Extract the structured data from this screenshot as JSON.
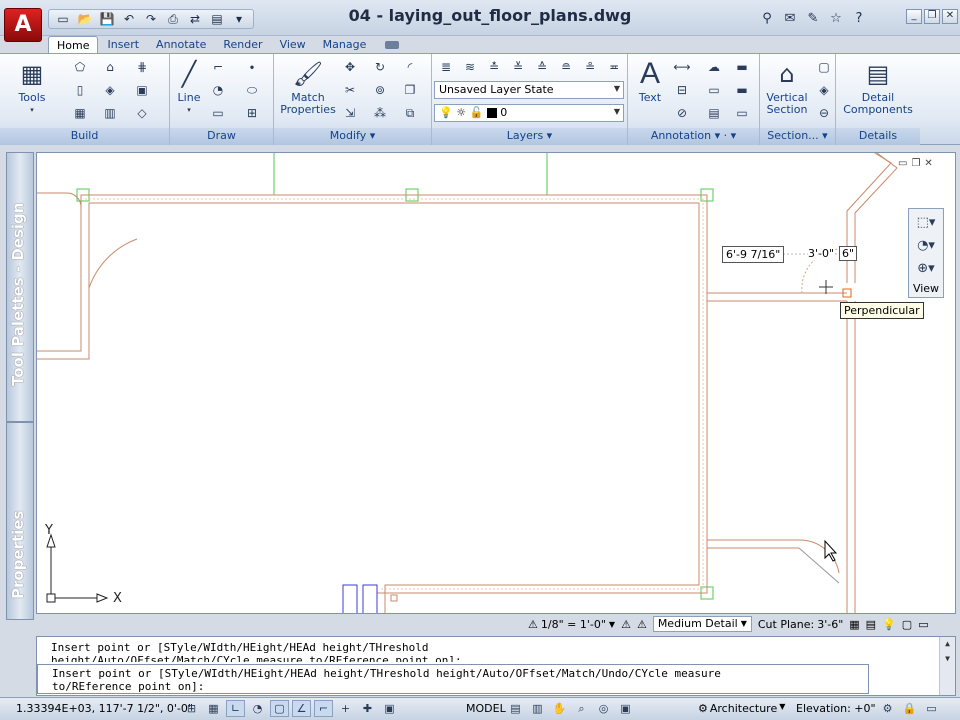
{
  "app": {
    "logo": "A",
    "document_title": "04 - laying_out_floor_plans.dwg"
  },
  "quick_access": [
    "new-icon",
    "open-icon",
    "save-icon",
    "undo-icon",
    "redo-icon",
    "print-icon",
    "publish-icon",
    "properties-icon"
  ],
  "info_tools": [
    "binoculars-icon",
    "subscription-icon",
    "tools-icon",
    "star-icon",
    "help-icon"
  ],
  "window_controls": {
    "minimize": "_",
    "restore": "❐",
    "close": "✕"
  },
  "tabs": [
    {
      "label": "Home",
      "active": true
    },
    {
      "label": "Insert",
      "active": false
    },
    {
      "label": "Annotate",
      "active": false
    },
    {
      "label": "Render",
      "active": false
    },
    {
      "label": "View",
      "active": false
    },
    {
      "label": "Manage",
      "active": false
    }
  ],
  "ribbon": {
    "build": {
      "title": "Build",
      "tools_label": "Tools"
    },
    "draw": {
      "title": "Draw",
      "line_label": "Line"
    },
    "modify": {
      "title": "Modify",
      "match_label_1": "Match",
      "match_label_2": "Properties"
    },
    "layers": {
      "title": "Layers",
      "layer_state": "Unsaved Layer State",
      "current_layer": "0"
    },
    "annotation": {
      "title": "Annotation",
      "text_label": "Text"
    },
    "section": {
      "title": "Section...",
      "vertical_label_1": "Vertical",
      "vertical_label_2": "Section"
    },
    "details": {
      "title": "Details",
      "detail_label_1": "Detail",
      "detail_label_2": "Components"
    }
  },
  "palettes": {
    "design": "Tool Palettes - Design",
    "properties": "Properties"
  },
  "drawing": {
    "dim_1": "6'-9 7/16\"",
    "dim_2": "3'-0\"",
    "dim_3": "6\"",
    "osnap_tooltip": "Perpendicular",
    "ucs_x": "X",
    "ucs_y": "Y",
    "view_label": "View"
  },
  "drawing_status": {
    "scale": "1/8\" = 1'-0\"",
    "detail": "Medium Detail",
    "cut_plane_label": "Cut Plane:",
    "cut_plane_value": "3'-6\""
  },
  "command_line": {
    "line1": "Insert point or [STyle/WIdth/HEight/HEAd height/THreshold",
    "line2": "height/Auto/OFfset/Match/CYcle measure to/REference point on]:",
    "line3": "Insert point or [STyle/WIdth/HEight/HEAd height/THreshold height/Auto/OFfset/Match/Undo/CYcle measure",
    "line4": "to/REference point on]:"
  },
  "status_bar": {
    "coordinates": "1.33394E+03, 117'-7 1/2\", 0'-0\"",
    "model": "MODEL",
    "workspace": "Architecture",
    "elevation": "Elevation: +0\""
  },
  "colors": {
    "accent": "#15428b",
    "wall_line": "#c98a6a",
    "grid_green": "#6fd26f",
    "ribbon_title": "#b2c6e1"
  }
}
